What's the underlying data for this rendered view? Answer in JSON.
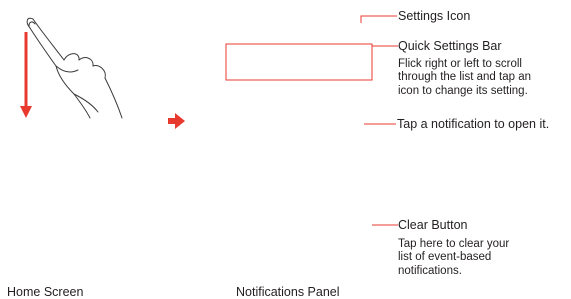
{
  "colors": {
    "accent": "#e8392f",
    "text": "#231f20",
    "line_art": "#3a3a3a"
  },
  "icons": {
    "hand": "hand-swipe-down-icon",
    "arrow": "right-arrow-icon"
  },
  "callouts": {
    "settings_icon": {
      "title": "Settings Icon"
    },
    "quick_settings_bar": {
      "title": "Quick Settings Bar",
      "description": "Flick right or left to scroll\nthrough the list and tap an\nicon to change its setting."
    },
    "notification": {
      "title": "Tap a notification to open it."
    },
    "clear_button": {
      "title": "Clear Button",
      "description": "Tap here to clear your\nlist of event-based\nnotifications."
    }
  },
  "captions": {
    "home_screen": "Home Screen",
    "notifications_panel": "Notifications Panel"
  }
}
